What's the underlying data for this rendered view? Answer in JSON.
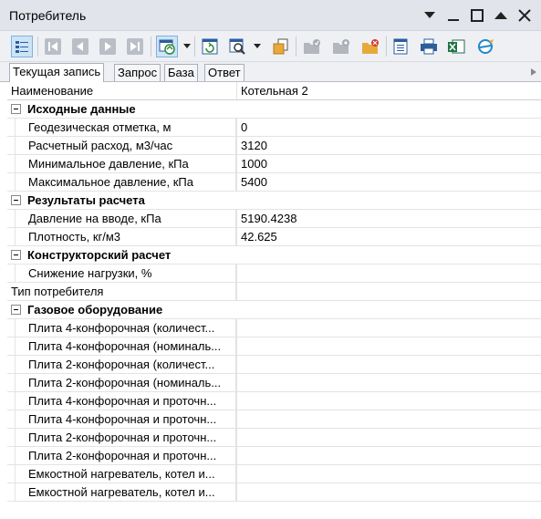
{
  "window": {
    "title": "Потребитель"
  },
  "toolbar": {
    "buttons": [
      {
        "id": "view-toggle",
        "icon": "grid-view-icon"
      },
      {
        "id": "first",
        "icon": "first-record-icon"
      },
      {
        "id": "prev",
        "icon": "prev-record-icon"
      },
      {
        "id": "next",
        "icon": "next-record-icon"
      },
      {
        "id": "last",
        "icon": "last-record-icon"
      },
      {
        "id": "sync",
        "icon": "sync-icon"
      },
      {
        "id": "refresh",
        "icon": "refresh-icon"
      },
      {
        "id": "find",
        "icon": "find-icon"
      },
      {
        "id": "copy",
        "icon": "copy-icon"
      },
      {
        "id": "folder-check",
        "icon": "folder-check-icon"
      },
      {
        "id": "folder-add",
        "icon": "folder-add-icon"
      },
      {
        "id": "folder-delete",
        "icon": "folder-delete-icon"
      },
      {
        "id": "report",
        "icon": "report-icon"
      },
      {
        "id": "print",
        "icon": "print-icon"
      },
      {
        "id": "excel",
        "icon": "excel-icon"
      },
      {
        "id": "web",
        "icon": "web-icon"
      }
    ]
  },
  "tabs": [
    "Текущая запись",
    "Запрос",
    "База",
    "Ответ"
  ],
  "grid": {
    "name_row": {
      "label": "Наименование",
      "value": "Котельная 2"
    },
    "sections": [
      {
        "title": "Исходные данные",
        "rows": [
          {
            "label": "Геодезическая отметка, м",
            "value": "0"
          },
          {
            "label": "Расчетный расход, м3/час",
            "value": "3120"
          },
          {
            "label": "Минимальное давление,  кПа",
            "value": "1000"
          },
          {
            "label": "Максимальное давление,  кПа",
            "value": "5400"
          }
        ]
      },
      {
        "title": "Результаты расчета",
        "rows": [
          {
            "label": "Давление на вводе,  кПа",
            "value": "5190.4238"
          },
          {
            "label": "Плотность, кг/м3",
            "value": "42.625"
          }
        ]
      },
      {
        "title": "Конструкторский расчет",
        "rows": [
          {
            "label": "Снижение нагрузки, %",
            "value": ""
          }
        ]
      }
    ],
    "consumer_type": {
      "label": "Тип потребителя",
      "value": ""
    },
    "gas_section": {
      "title": "Газовое оборудование",
      "rows": [
        {
          "label": "Плита 4-конфорочная (количест...",
          "value": ""
        },
        {
          "label": "Плита 4-конфорочная (номиналь...",
          "value": ""
        },
        {
          "label": "Плита 2-конфорочная (количест...",
          "value": ""
        },
        {
          "label": "Плита 2-конфорочная (номиналь...",
          "value": ""
        },
        {
          "label": "Плита 4-конфорочная и проточн...",
          "value": ""
        },
        {
          "label": "Плита 4-конфорочная и проточн...",
          "value": ""
        },
        {
          "label": "Плита 2-конфорочная и проточн...",
          "value": ""
        },
        {
          "label": "Плита 2-конфорочная и проточн...",
          "value": ""
        },
        {
          "label": "Емкостной нагреватель, котел и...",
          "value": ""
        },
        {
          "label": "Емкостной нагреватель, котел и...",
          "value": ""
        }
      ]
    }
  }
}
